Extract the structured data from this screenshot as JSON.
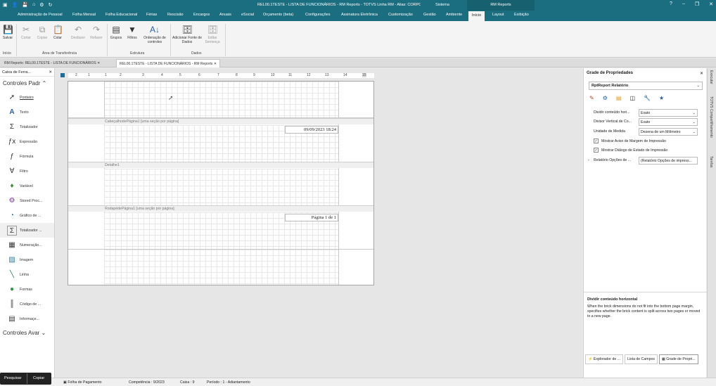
{
  "titlebar": {
    "title": "REL00.1TESTE - LISTA DE FUNCIONÁRIOS - RM Reports - TOTVS Linha RM - Alias: CORPORE_DTSX | 1-TESTE",
    "context_sistema": "Sistema",
    "context_rmreports": "RM Reports"
  },
  "tabs": [
    "Administração de Pessoal",
    "Folha Mensal",
    "Folha Educacional",
    "Férias",
    "Rescisão",
    "Encargos",
    "Anuais",
    "eSocial",
    "Orçamento (beta)",
    "Configurações",
    "Assinatura Eletrônica",
    "Customização",
    "Gestão",
    "Ambiente",
    "Início",
    "Layout",
    "Exibição"
  ],
  "ribbon": {
    "buttons": [
      "Salvar",
      "Cortar",
      "Copiar",
      "Colar",
      "Desfazer",
      "Refazer",
      "Grupos",
      "Filtros",
      "Ordenação de controles",
      "Adicionar Fonte de Dados",
      "Editar Sentença"
    ],
    "groups": [
      "Início",
      "Área de Transferência",
      "Estrutura",
      "Dados"
    ]
  },
  "doctabs": [
    "RM Reports: REL00.1TESTE - LISTA DE FUNCIONÁRIOS",
    "REL00.1TESTE - LISTA DE FUNCIONÁRIOS - RM Reports"
  ],
  "toolbox": {
    "title": "Caixa de Ferra...",
    "category1": "Controles Padr",
    "category2": "Controles Avar",
    "items": [
      "Ponteiro",
      "Texto",
      "Totalizador",
      "Expressão",
      "Fórmula",
      "Filtro",
      "Variável",
      "Stored Proc...",
      "Gráfico de ...",
      "Totalizador ...",
      "Numeração...",
      "Imagem",
      "Linha",
      "Formas",
      "Código de ...",
      "Informaçe..."
    ]
  },
  "ruler": [
    "2",
    "1",
    "1",
    "2",
    "3",
    "4",
    "5",
    "6",
    "7",
    "8",
    "9",
    "10",
    "11",
    "12",
    "13",
    "14",
    "15",
    "16",
    "17",
    "18",
    "19"
  ],
  "bands": {
    "header": "CabeçalhodePágina1 [uma seção por página]",
    "detail": "Detalhe1",
    "footer": "RodapédePágina1 [uma seção por página]",
    "date": "09/09/2023 18:24",
    "page": "Página 1 de 1"
  },
  "props": {
    "title": "Grade de Propriedades",
    "object": "RptReport  Relatório",
    "rows": [
      {
        "label": "Dividir conteúdo hori...",
        "value": "Exato"
      },
      {
        "label": "Divisor Vertical de Co...",
        "value": "Exato"
      },
      {
        "label": "Unidade de Medida",
        "value": "Dezena de um Milímetro"
      }
    ],
    "checks": [
      "Mostrar Aviso de Margem de Impressão",
      "Mostrar Diálogo de Estado de Impressão"
    ],
    "expand": {
      "label": "Relatório Opções de ...",
      "value": "(Relatório Opções de impress..."
    },
    "desc_title": "Dividir conteúdo horizontal",
    "desc": "When the brick dimensions do not fit into the bottom page margin, specifies whether the brick content is split across two pages or moved to a new page.",
    "bottom_tabs": [
      "Explorador de ...",
      "Lista de Campos",
      "Grade de Propri..."
    ]
  },
  "side": [
    "Executar",
    "TOTVS Compartilhamento",
    "Tarefas"
  ],
  "status": {
    "folha": "Folha de Pagamento",
    "comp": "Competência : 9/2023",
    "caixa": "Caixa : 9",
    "periodo": "Período : 1 - Adiantamento"
  },
  "popup": {
    "search": "Pesquisar",
    "copy": "Copiar"
  }
}
